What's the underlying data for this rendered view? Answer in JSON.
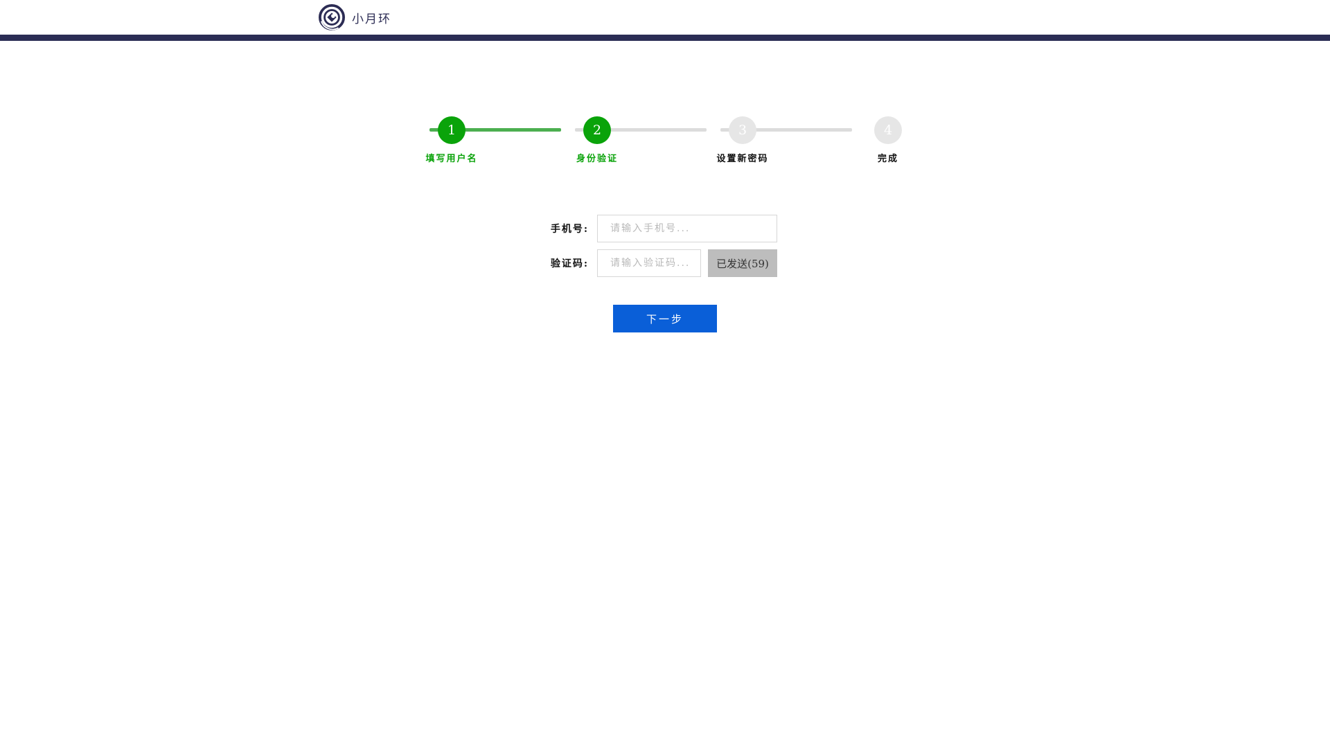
{
  "header": {
    "logo_text": "小月环",
    "logo_icon": "moon-ring-logo-icon",
    "bar_color": "#2b2d55"
  },
  "stepper": {
    "current_step": 2,
    "active_color": "#0aa30a",
    "inactive_color": "#e6e6e6",
    "steps": [
      {
        "number": "1",
        "label": "填写用户名",
        "status": "done"
      },
      {
        "number": "2",
        "label": "身份验证",
        "status": "done"
      },
      {
        "number": "3",
        "label": "设置新密码",
        "status": "todo"
      },
      {
        "number": "4",
        "label": "完成",
        "status": "todo"
      }
    ]
  },
  "form": {
    "phone": {
      "label": "手机号:",
      "value": "",
      "placeholder": "请输入手机号..."
    },
    "code": {
      "label": "验证码:",
      "value": "",
      "placeholder": "请输入验证码..."
    },
    "send_button": {
      "label": "已发送(59)",
      "color": "#bdbdbd"
    },
    "next_button": {
      "label": "下一步",
      "color": "#0a5fd8"
    }
  }
}
